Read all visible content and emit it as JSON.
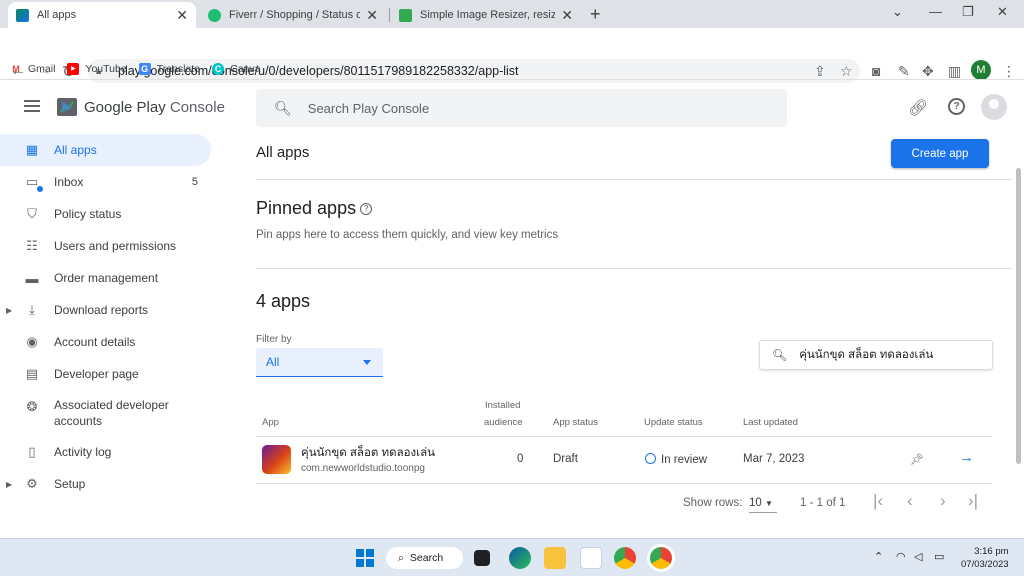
{
  "browser": {
    "tabs": [
      {
        "title": "All apps",
        "active": true
      },
      {
        "title": "Fiverr / Shopping / Status of your",
        "active": false
      },
      {
        "title": "Simple Image Resizer, resize onli",
        "active": false
      }
    ],
    "new_tab": "+",
    "url": "play.google.com/console/u/0/developers/8011517989182258332/app-list",
    "profile_initial": "M",
    "bookmarks": [
      "Gmail",
      "YouTube",
      "Translate",
      "Canva"
    ]
  },
  "console": {
    "logo_text_1": "Google Play",
    "logo_text_2": " Console",
    "search_placeholder": "Search Play Console",
    "sidebar": [
      {
        "label": "All apps",
        "icon": "grid-icon",
        "glyph": "▦",
        "active": true
      },
      {
        "label": "Inbox",
        "icon": "inbox-icon",
        "glyph": "▭",
        "count": "5"
      },
      {
        "label": "Policy status",
        "icon": "shield-icon",
        "glyph": "⛉"
      },
      {
        "label": "Users and permissions",
        "icon": "users-icon",
        "glyph": "☷"
      },
      {
        "label": "Order management",
        "icon": "card-icon",
        "glyph": "▬"
      },
      {
        "label": "Download reports",
        "icon": "download-icon",
        "glyph": "⤓",
        "expandable": true
      },
      {
        "label": "Account details",
        "icon": "account-icon",
        "glyph": "◉"
      },
      {
        "label": "Developer page",
        "icon": "page-icon",
        "glyph": "▤"
      },
      {
        "label": "Associated developer accounts",
        "icon": "linked-accounts-icon",
        "glyph": "❂"
      },
      {
        "label": "Activity log",
        "icon": "log-icon",
        "glyph": "▯"
      },
      {
        "label": "Setup",
        "icon": "settings-icon",
        "glyph": "⚙",
        "expandable": true
      }
    ],
    "page_title": "All apps",
    "create_app": "Create app",
    "pinned_title": "Pinned apps",
    "pinned_subtitle": "Pin apps here to access them quickly, and view key metrics",
    "apps_count": "4 apps",
    "filter_label": "Filter by",
    "filter_value": "All",
    "filter_search_value": "คุ่นนักขุด สล็อต ทดลองเล่น",
    "table_headers": {
      "app": "App",
      "installed_1": "Installed",
      "installed_2": "audience",
      "app_status": "App status",
      "update_status": "Update status",
      "last_updated": "Last updated"
    },
    "rows": [
      {
        "name": "คุ่นนักขุด สล็อต ทดลองเล่น",
        "package": "com.newworldstudio.toonpg",
        "installed": "0",
        "app_status": "Draft",
        "update_status": "In review",
        "last_updated": "Mar 7, 2023"
      }
    ],
    "pager": {
      "rows_label": "Show rows:",
      "rows_value": "10",
      "range": "1 - 1 of 1"
    }
  },
  "taskbar": {
    "search": "Search",
    "time": "3:16 pm",
    "date": "07/03/2023"
  }
}
